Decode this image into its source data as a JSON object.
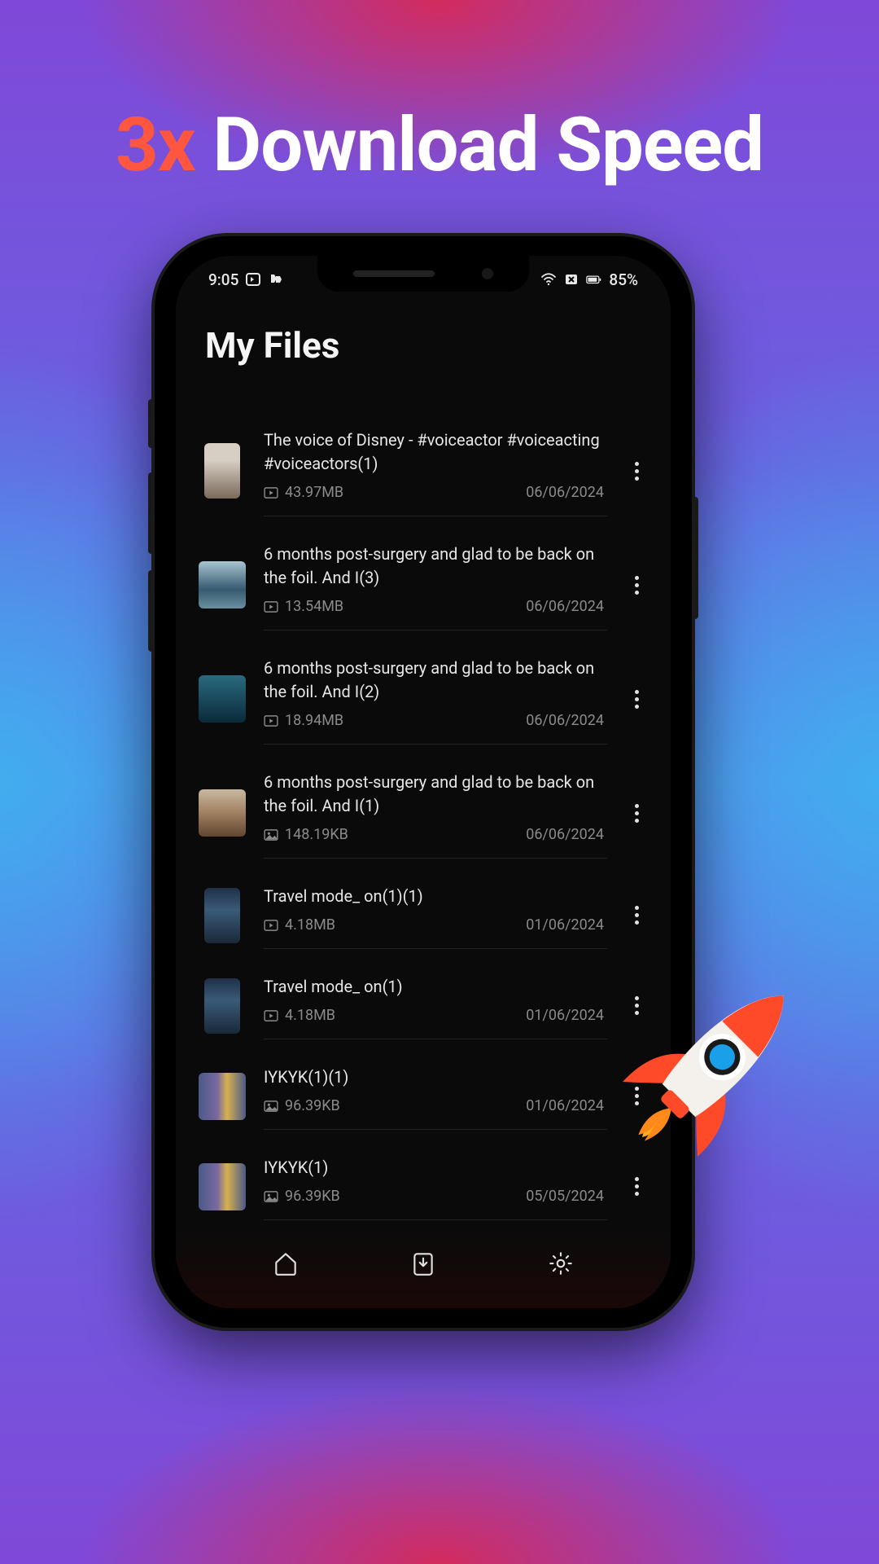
{
  "headline": {
    "accent": "3x",
    "rest": " Download Speed"
  },
  "status": {
    "time": "9:05",
    "battery": "85%"
  },
  "page": {
    "title": "My Files"
  },
  "files": [
    {
      "title": "The voice of Disney -  #voiceactor #voiceacting #voiceactors(1)",
      "type": "video",
      "size": "43.97MB",
      "date": "06/06/2024",
      "thumb": "t0",
      "tall": true
    },
    {
      "title": "6 months post-surgery and glad to be back on the foil. And I(3)",
      "type": "video",
      "size": "13.54MB",
      "date": "06/06/2024",
      "thumb": "t1"
    },
    {
      "title": "6 months post-surgery and glad to be back on the foil. And I(2)",
      "type": "video",
      "size": "18.94MB",
      "date": "06/06/2024",
      "thumb": "t2"
    },
    {
      "title": "6 months post-surgery and glad to be back on the foil. And I(1)",
      "type": "image",
      "size": "148.19KB",
      "date": "06/06/2024",
      "thumb": "t3"
    },
    {
      "title": "Travel mode_ on(1)(1)",
      "type": "video",
      "size": "4.18MB",
      "date": "01/06/2024",
      "thumb": "t4",
      "tall": true
    },
    {
      "title": "Travel mode_ on(1)",
      "type": "video",
      "size": "4.18MB",
      "date": "01/06/2024",
      "thumb": "t5",
      "tall": true
    },
    {
      "title": "IYKYK(1)(1)",
      "type": "image",
      "size": "96.39KB",
      "date": "01/06/2024",
      "thumb": "t6"
    },
    {
      "title": "IYKYK(1)",
      "type": "image",
      "size": "96.39KB",
      "date": "05/05/2024",
      "thumb": "t7"
    }
  ],
  "icons": {
    "video": "video-icon",
    "image": "image-icon"
  }
}
